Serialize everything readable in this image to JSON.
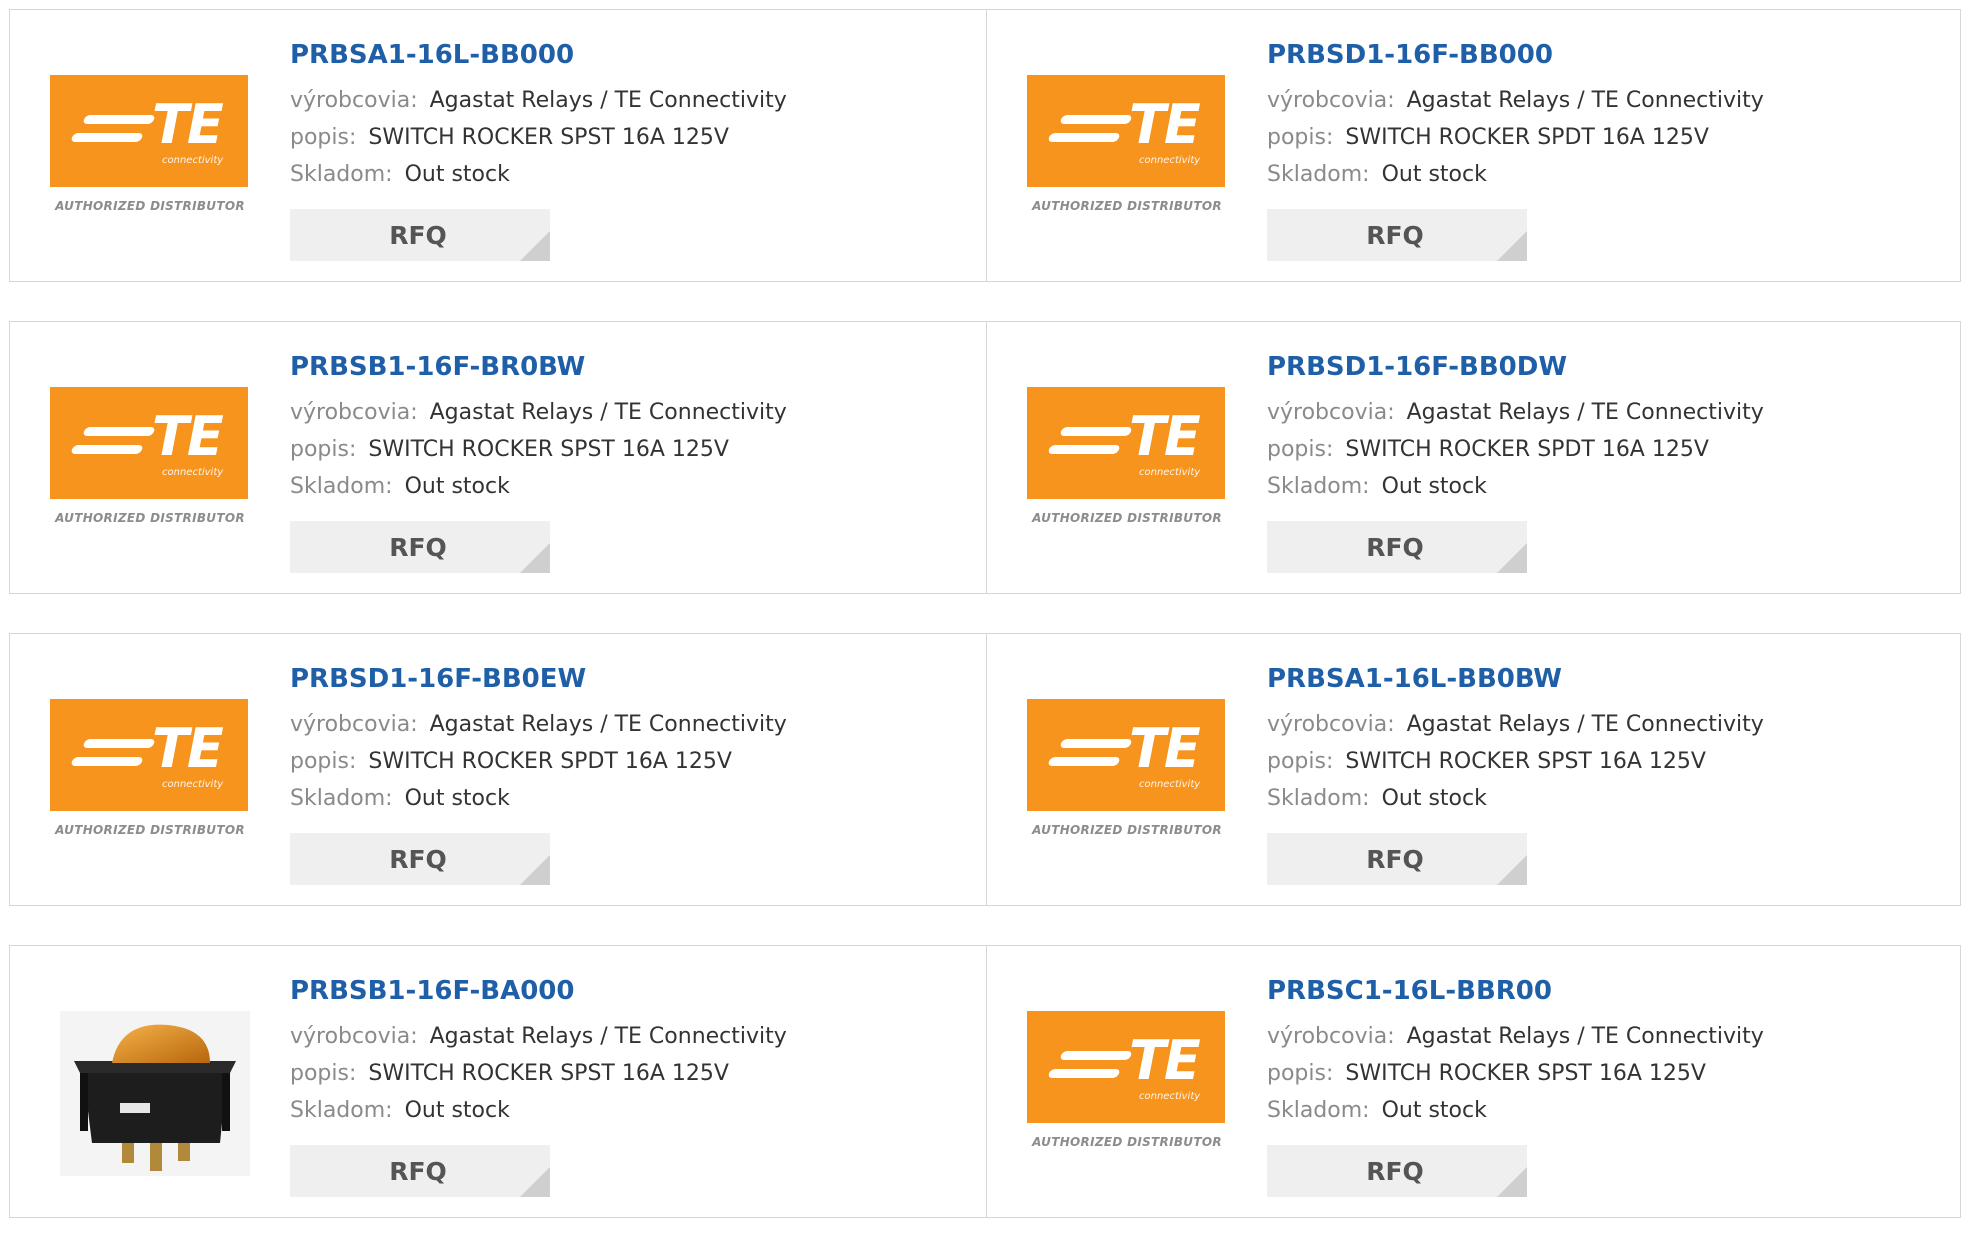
{
  "labels": {
    "manufacturer": "výrobcovia:",
    "description": "popis:",
    "stock": "Skladom:",
    "rfq": "RFQ"
  },
  "brand_logo": {
    "letters": "TE",
    "sub": "connectivity",
    "tagline": "AUTHORIZED DISTRIBUTOR",
    "color": "#f7941d"
  },
  "products": [
    {
      "part": "PRBSA1-16L-BB000",
      "manufacturer": "Agastat Relays / TE Connectivity",
      "description": "SWITCH ROCKER SPST 16A 125V",
      "stock": "Out stock",
      "image": "te-logo"
    },
    {
      "part": "PRBSD1-16F-BB000",
      "manufacturer": "Agastat Relays / TE Connectivity",
      "description": "SWITCH ROCKER SPDT 16A 125V",
      "stock": "Out stock",
      "image": "te-logo"
    },
    {
      "part": "PRBSB1-16F-BR0BW",
      "manufacturer": "Agastat Relays / TE Connectivity",
      "description": "SWITCH ROCKER SPST 16A 125V",
      "stock": "Out stock",
      "image": "te-logo"
    },
    {
      "part": "PRBSD1-16F-BB0DW",
      "manufacturer": "Agastat Relays / TE Connectivity",
      "description": "SWITCH ROCKER SPDT 16A 125V",
      "stock": "Out stock",
      "image": "te-logo"
    },
    {
      "part": "PRBSD1-16F-BB0EW",
      "manufacturer": "Agastat Relays / TE Connectivity",
      "description": "SWITCH ROCKER SPDT 16A 125V",
      "stock": "Out stock",
      "image": "te-logo"
    },
    {
      "part": "PRBSA1-16L-BB0BW",
      "manufacturer": "Agastat Relays / TE Connectivity",
      "description": "SWITCH ROCKER SPST 16A 125V",
      "stock": "Out stock",
      "image": "te-logo"
    },
    {
      "part": "PRBSB1-16F-BA000",
      "manufacturer": "Agastat Relays / TE Connectivity",
      "description": "SWITCH ROCKER SPST 16A 125V",
      "stock": "Out stock",
      "image": "rocker-switch-photo"
    },
    {
      "part": "PRBSC1-16L-BBR00",
      "manufacturer": "Agastat Relays / TE Connectivity",
      "description": "SWITCH ROCKER SPST 16A 125V",
      "stock": "Out stock",
      "image": "te-logo"
    }
  ]
}
